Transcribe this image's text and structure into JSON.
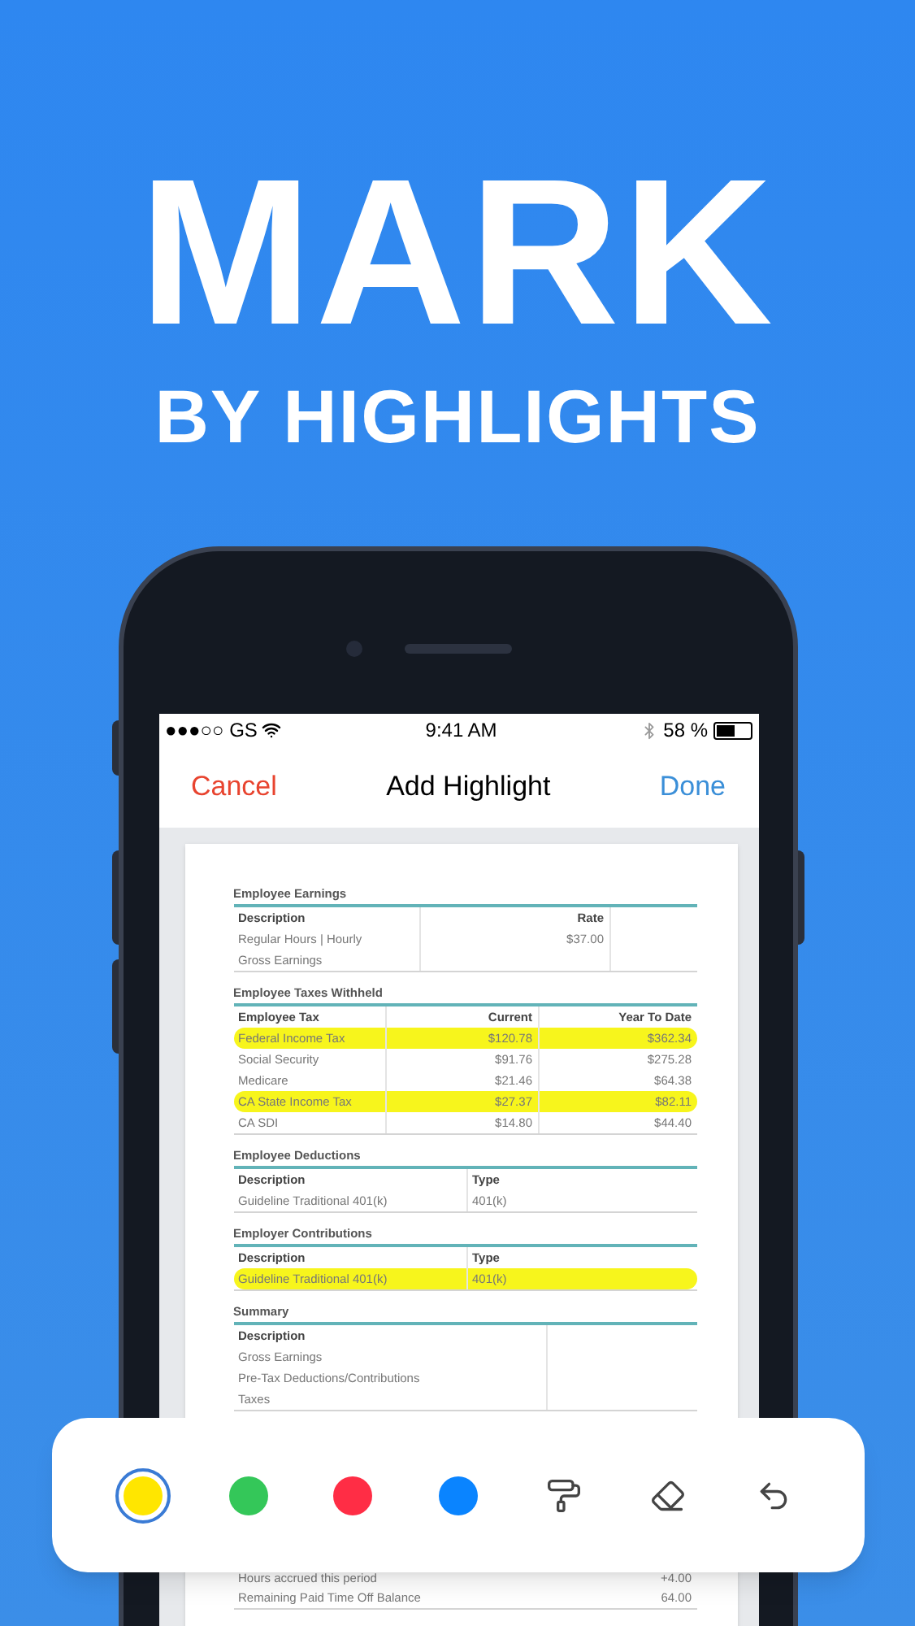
{
  "headline": {
    "title": "MARK",
    "subtitle": "BY HIGHLIGHTS"
  },
  "status_bar": {
    "carrier": "●●●○○ GS",
    "time": "9:41 AM",
    "battery": "58 %"
  },
  "nav_bar": {
    "cancel": "Cancel",
    "title": "Add Highlight",
    "done": "Done"
  },
  "document": {
    "sections": [
      {
        "title": "Employee Earnings",
        "columns": [
          "Description",
          "Rate"
        ],
        "rows": [
          {
            "cells": [
              "Regular Hours | Hourly",
              "$37.00"
            ],
            "highlighted": false
          },
          {
            "cells": [
              "Gross Earnings"
            ],
            "highlighted": false
          }
        ]
      },
      {
        "title": "Employee Taxes Withheld",
        "columns": [
          "Employee Tax",
          "Current",
          "Year To Date"
        ],
        "rows": [
          {
            "cells": [
              "Federal Income Tax",
              "$120.78",
              "$362.34"
            ],
            "highlighted": true
          },
          {
            "cells": [
              "Social Security",
              "$91.76",
              "$275.28"
            ],
            "highlighted": false
          },
          {
            "cells": [
              "Medicare",
              "$21.46",
              "$64.38"
            ],
            "highlighted": false
          },
          {
            "cells": [
              "CA State Income Tax",
              "$27.37",
              "$82.11"
            ],
            "highlighted": true
          },
          {
            "cells": [
              "CA SDI",
              "$14.80",
              "$44.40"
            ],
            "highlighted": false
          }
        ]
      },
      {
        "title": "Employee Deductions",
        "columns": [
          "Description",
          "Type"
        ],
        "rows": [
          {
            "cells": [
              "Guideline Traditional 401(k)",
              "401(k)"
            ],
            "highlighted": false
          }
        ]
      },
      {
        "title": "Employer Contributions",
        "columns": [
          "Description",
          "Type"
        ],
        "rows": [
          {
            "cells": [
              "Guideline Traditional 401(k)",
              "401(k)"
            ],
            "highlighted": true
          }
        ]
      },
      {
        "title": "Summary",
        "columns": [
          "Description"
        ],
        "rows": [
          {
            "cells": [
              "Gross Earnings"
            ],
            "highlighted": false
          },
          {
            "cells": [
              "Pre-Tax Deductions/Contributions"
            ],
            "highlighted": false
          },
          {
            "cells": [
              "Taxes"
            ],
            "highlighted": false
          }
        ]
      }
    ],
    "lower_rows": [
      {
        "cells": [
          "Hours accrued this period",
          "+4.00"
        ]
      },
      {
        "cells": [
          "Remaining Paid Time Off Balance",
          "64.00"
        ]
      }
    ]
  },
  "toolbar": [
    {
      "kind": "color",
      "color": "#ffe600",
      "selected": true
    },
    {
      "kind": "color",
      "color": "#34c759",
      "selected": false
    },
    {
      "kind": "color",
      "color": "#ff2d45",
      "selected": false
    },
    {
      "kind": "color",
      "color": "#0a84ff",
      "selected": false
    },
    {
      "kind": "roller"
    },
    {
      "kind": "eraser"
    },
    {
      "kind": "undo"
    }
  ]
}
